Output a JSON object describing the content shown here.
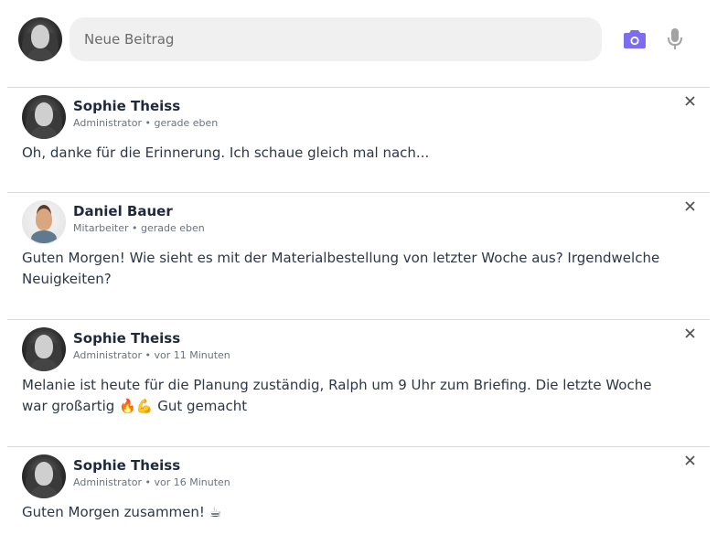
{
  "composer": {
    "placeholder": "Neue Beitrag",
    "camera_icon": "camera-icon",
    "mic_icon": "microphone-icon",
    "accent_color": "#7b6cf0"
  },
  "posts": [
    {
      "author": "Sophie Theiss",
      "role": "Administrator",
      "time": "gerade eben",
      "text": "Oh, danke für die Erinnerung. Ich schaue gleich mal nach..."
    },
    {
      "author": "Daniel Bauer",
      "role": "Mitarbeiter",
      "time": "gerade eben",
      "text": "Guten Morgen! Wie sieht es mit der Materialbestellung von letzter Woche aus? Irgendwelche Neuigkeiten?"
    },
    {
      "author": "Sophie Theiss",
      "role": "Administrator",
      "time": "vor 11 Minuten",
      "text": "Melanie ist heute für die Planung zuständig, Ralph um 9 Uhr zum Briefing. Die letzte Woche war großartig 🔥💪 Gut gemacht"
    },
    {
      "author": "Sophie Theiss",
      "role": "Administrator",
      "time": "vor 16 Minuten",
      "text": "Guten Morgen zusammen! ☕"
    }
  ],
  "separator": " • "
}
